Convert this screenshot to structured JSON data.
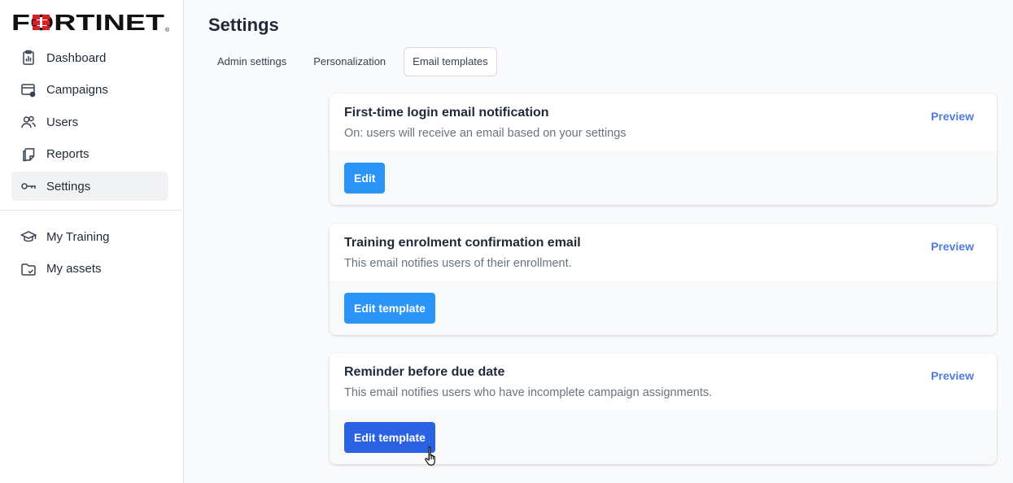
{
  "brand": {
    "logo_text": "FORTINET",
    "logo_color": "#d91f26"
  },
  "sidebar": {
    "items": [
      {
        "label": "Dashboard",
        "icon": "clipboard-chart-icon"
      },
      {
        "label": "Campaigns",
        "icon": "campaign-settings-icon"
      },
      {
        "label": "Users",
        "icon": "users-icon"
      },
      {
        "label": "Reports",
        "icon": "report-icon"
      },
      {
        "label": "Settings",
        "icon": "key-icon",
        "active": true
      }
    ],
    "secondary_items": [
      {
        "label": "My Training",
        "icon": "graduation-cap-icon"
      },
      {
        "label": "My assets",
        "icon": "folder-check-icon"
      }
    ]
  },
  "page": {
    "title": "Settings",
    "tabs": [
      {
        "label": "Admin settings"
      },
      {
        "label": "Personalization"
      },
      {
        "label": "Email templates",
        "active": true
      }
    ]
  },
  "cards": [
    {
      "title": "First-time login email notification",
      "description": "On: users will receive an email based on your settings",
      "preview_label": "Preview",
      "button_label": "Edit"
    },
    {
      "title": "Training enrolment confirmation email",
      "description": "This email notifies users of their enrollment.",
      "preview_label": "Preview",
      "button_label": "Edit template"
    },
    {
      "title": "Reminder before due date",
      "description": "This email notifies users who have incomplete campaign assignments.",
      "preview_label": "Preview",
      "button_label": "Edit template",
      "hovered": true
    }
  ],
  "colors": {
    "accent": "#2a95f7",
    "accent_hover": "#2b62e3",
    "link": "#4f7ae0"
  }
}
